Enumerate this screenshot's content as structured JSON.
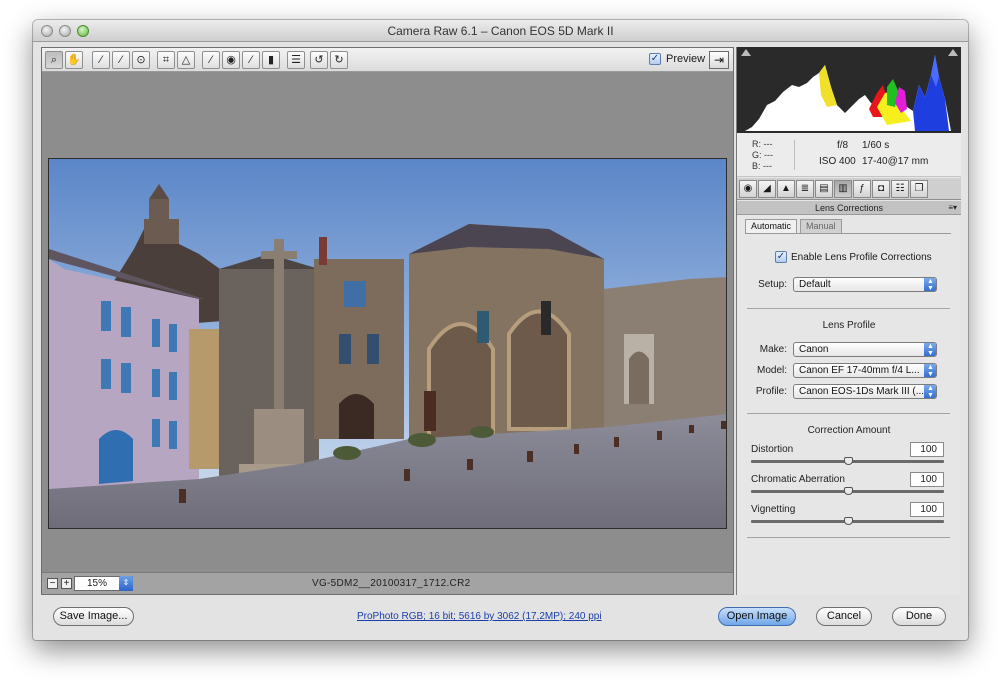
{
  "window": {
    "title": "Camera Raw 6.1  –  Canon EOS 5D Mark II"
  },
  "toolbar": {
    "tools": [
      {
        "icon": "zoom-icon",
        "glyph": "⌕"
      },
      {
        "icon": "hand-icon",
        "glyph": "✋"
      },
      {
        "icon": "white-balance-icon",
        "glyph": "⁄"
      },
      {
        "icon": "color-sampler-icon",
        "glyph": "⁄"
      },
      {
        "icon": "targeted-adjustment-icon",
        "glyph": "⊙"
      },
      {
        "icon": "crop-icon",
        "glyph": "⌗"
      },
      {
        "icon": "straighten-icon",
        "glyph": "△"
      },
      {
        "icon": "spot-removal-icon",
        "glyph": "⁄"
      },
      {
        "icon": "red-eye-icon",
        "glyph": "◉"
      },
      {
        "icon": "adjustment-brush-icon",
        "glyph": "⁄"
      },
      {
        "icon": "graduated-filter-icon",
        "glyph": "▮"
      },
      {
        "icon": "preferences-icon",
        "glyph": "☰"
      },
      {
        "icon": "rotate-left-icon",
        "glyph": "↺"
      },
      {
        "icon": "rotate-right-icon",
        "glyph": "↻"
      }
    ],
    "preview_label": "Preview",
    "preview_checked": true
  },
  "status": {
    "zoom": "15%",
    "filename": "VG-5DM2__20100317_1712.CR2"
  },
  "readout": {
    "r": "R:",
    "g": "G:",
    "b": "B:",
    "dashes": "---",
    "aperture": "f/8",
    "shutter": "1/60 s",
    "iso": "ISO 400",
    "lens": "17-40@17 mm"
  },
  "panel_tabs": [
    "basic",
    "tone-curve",
    "detail",
    "hsl",
    "split-toning",
    "lens-corrections",
    "effects",
    "camera-calibration",
    "presets",
    "snapshots"
  ],
  "lens_corrections": {
    "header": "Lens Corrections",
    "tab_automatic": "Automatic",
    "tab_manual": "Manual",
    "enable_label": "Enable Lens Profile Corrections",
    "enable_checked": true,
    "setup_label": "Setup:",
    "setup_value": "Default",
    "lens_profile_title": "Lens Profile",
    "make_label": "Make:",
    "make_value": "Canon",
    "model_label": "Model:",
    "model_value": "Canon EF 17-40mm f/4 L...",
    "profile_label": "Profile:",
    "profile_value": "Canon EOS-1Ds Mark III (...",
    "correction_title": "Correction Amount",
    "sliders": [
      {
        "label": "Distortion",
        "value": "100",
        "level": 0.5
      },
      {
        "label": "Chromatic Aberration",
        "value": "100",
        "level": 0.5
      },
      {
        "label": "Vignetting",
        "value": "100",
        "level": 0.5
      }
    ]
  },
  "bottom": {
    "save": "Save Image...",
    "workflow": "ProPhoto RGB; 16 bit; 5616 by 3062 (17,2MP); 240 ppi",
    "open": "Open Image",
    "cancel": "Cancel",
    "done": "Done"
  }
}
